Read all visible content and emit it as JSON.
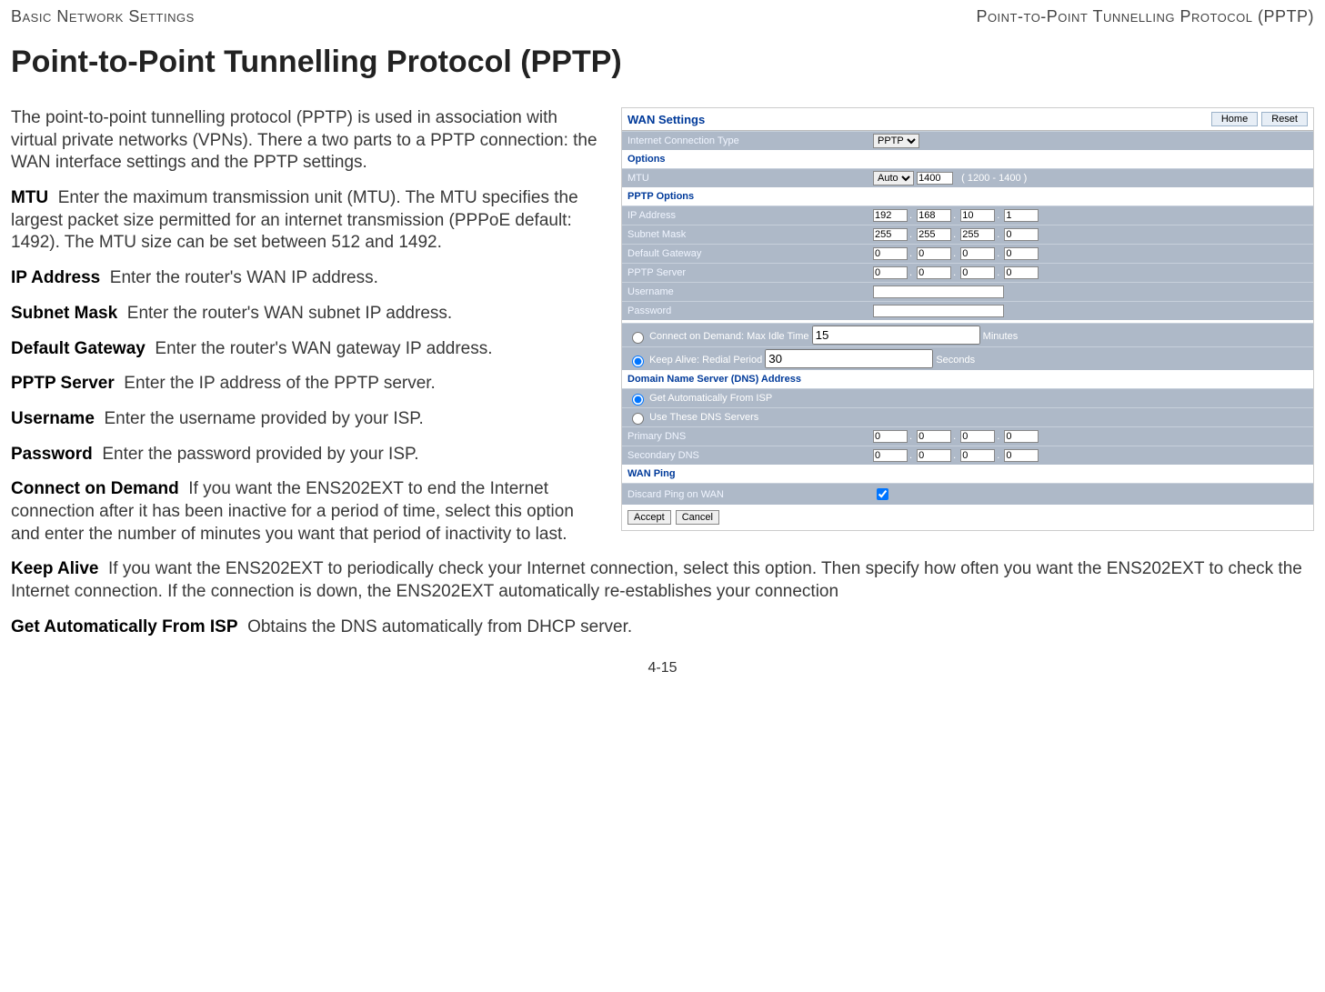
{
  "topbar": {
    "left": "Basic Network Settings",
    "right": "Point-to-Point Tunnelling Protocol (PPTP)"
  },
  "title": "Point-to-Point Tunnelling Protocol (PPTP)",
  "intro": "The point-to-point tunnelling protocol (PPTP) is used in association with virtual private networks (VPNs). There a two parts to a PPTP connection: the WAN interface settings and the PPTP settings.",
  "fields": {
    "mtu": {
      "label": "MTU",
      "text": "Enter the maximum transmission unit (MTU). The MTU specifies the largest packet size permitted for an internet transmission (PPPoE default: 1492). The MTU size can be set between 512 and 1492."
    },
    "ip_address": {
      "label": "IP Address",
      "text": "Enter the router's WAN IP address."
    },
    "subnet_mask": {
      "label": "Subnet Mask",
      "text": "Enter the router's WAN subnet IP address."
    },
    "default_gateway": {
      "label": "Default Gateway",
      "text": "Enter the router's WAN gateway IP address."
    },
    "pptp_server": {
      "label": "PPTP Server",
      "text": "Enter the IP address of the PPTP server."
    },
    "username": {
      "label": "Username",
      "text": "Enter the username provided by your ISP."
    },
    "password": {
      "label": "Password",
      "text": "Enter the password provided by your ISP."
    },
    "connect_on_demand": {
      "label": "Connect on Demand",
      "text": "If you want the ENS202EXT to end the Internet connection after it has been inactive for a period of time, select this option and enter the number of minutes you want that period of inactivity to last."
    },
    "keep_alive": {
      "label": "Keep Alive",
      "text": "If you want the ENS202EXT to periodically check your Internet connection, select this option. Then specify how often you want the ENS202EXT to check the Internet connection. If the connection is down, the ENS202EXT automatically re-establishes your connection"
    },
    "get_auto": {
      "label": "Get Automatically From ISP",
      "text": "Obtains the DNS automatically from DHCP server."
    }
  },
  "figure": {
    "panel_title": "WAN Settings",
    "buttons": {
      "home": "Home",
      "reset": "Reset"
    },
    "conn_type": {
      "label": "Internet Connection Type",
      "value": "PPTP"
    },
    "options_label": "Options",
    "mtu": {
      "label": "MTU",
      "mode": "Auto",
      "value": "1400",
      "range": "( 1200 - 1400 )"
    },
    "pptp_label": "PPTP Options",
    "rows": {
      "ip": {
        "label": "IP Address",
        "o1": "192",
        "o2": "168",
        "o3": "10",
        "o4": "1"
      },
      "mask": {
        "label": "Subnet Mask",
        "o1": "255",
        "o2": "255",
        "o3": "255",
        "o4": "0"
      },
      "gw": {
        "label": "Default Gateway",
        "o1": "0",
        "o2": "0",
        "o3": "0",
        "o4": "0"
      },
      "srv": {
        "label": "PPTP Server",
        "o1": "0",
        "o2": "0",
        "o3": "0",
        "o4": "0"
      },
      "user": {
        "label": "Username",
        "value": ""
      },
      "pass": {
        "label": "Password",
        "value": ""
      }
    },
    "conn_demand": {
      "label_pre": "Connect on Demand: Max Idle Time",
      "value": "15",
      "label_post": "Minutes"
    },
    "keep_alive": {
      "label_pre": "Keep Alive: Redial Period",
      "value": "30",
      "label_post": "Seconds"
    },
    "dns_label": "Domain Name Server (DNS) Address",
    "dns_auto": "Get Automatically From ISP",
    "dns_these": "Use These DNS Servers",
    "dns_primary": {
      "label": "Primary DNS",
      "o1": "0",
      "o2": "0",
      "o3": "0",
      "o4": "0"
    },
    "dns_secondary": {
      "label": "Secondary DNS",
      "o1": "0",
      "o2": "0",
      "o3": "0",
      "o4": "0"
    },
    "wan_ping_label": "WAN Ping",
    "discard_ping": "Discard Ping on WAN",
    "accept": "Accept",
    "cancel": "Cancel"
  },
  "page_number": "4-15"
}
